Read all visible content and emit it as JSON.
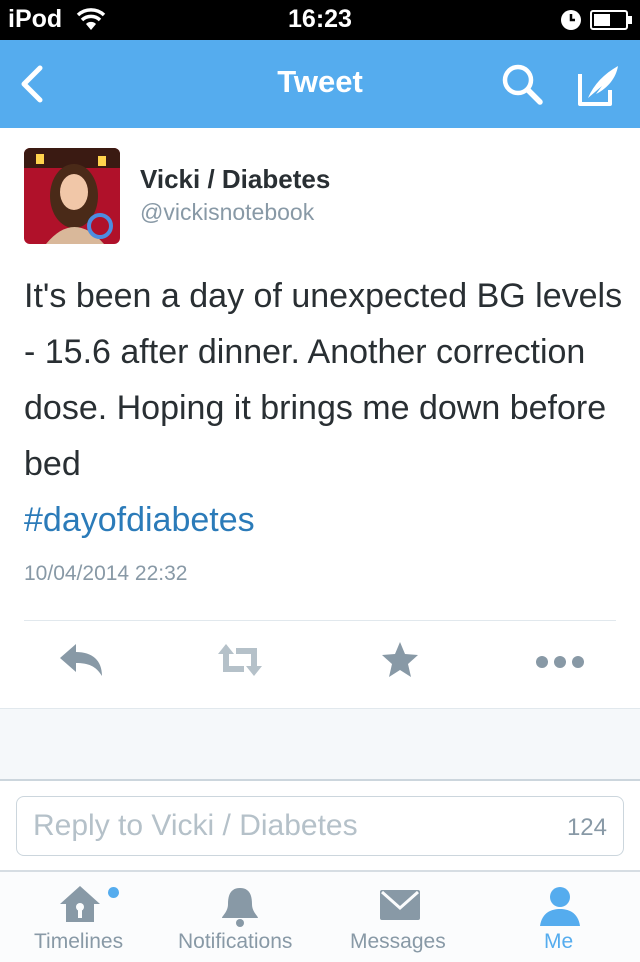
{
  "status_bar": {
    "carrier": "iPod",
    "time": "16:23"
  },
  "nav": {
    "title": "Tweet",
    "back_icon": "chevron-left-icon",
    "search_icon": "search-icon",
    "compose_icon": "compose-quill-icon"
  },
  "tweet": {
    "author_name": "Vicki / Diabetes",
    "author_handle": "@vickisnotebook",
    "text": "It's been a day of unexpected BG levels -  15.6 after dinner. Another correction dose. Hoping it brings me down before bed",
    "hashtag": "#dayofdiabetes",
    "timestamp": "10/04/2014 22:32",
    "actions": [
      "reply-icon",
      "retweet-icon",
      "favorite-icon",
      "more-icon"
    ]
  },
  "reply": {
    "placeholder": "Reply to Vicki / Diabetes",
    "count": "124"
  },
  "tabs": [
    {
      "label": "Timelines",
      "icon": "home-icon",
      "has_notification_dot": true
    },
    {
      "label": "Notifications",
      "icon": "bell-icon"
    },
    {
      "label": "Messages",
      "icon": "envelope-icon"
    },
    {
      "label": "Me",
      "icon": "person-icon",
      "active": true
    }
  ],
  "colors": {
    "brand": "#55acee",
    "link": "#2b7bb9",
    "text": "#292f33",
    "muted": "#8899a6"
  }
}
